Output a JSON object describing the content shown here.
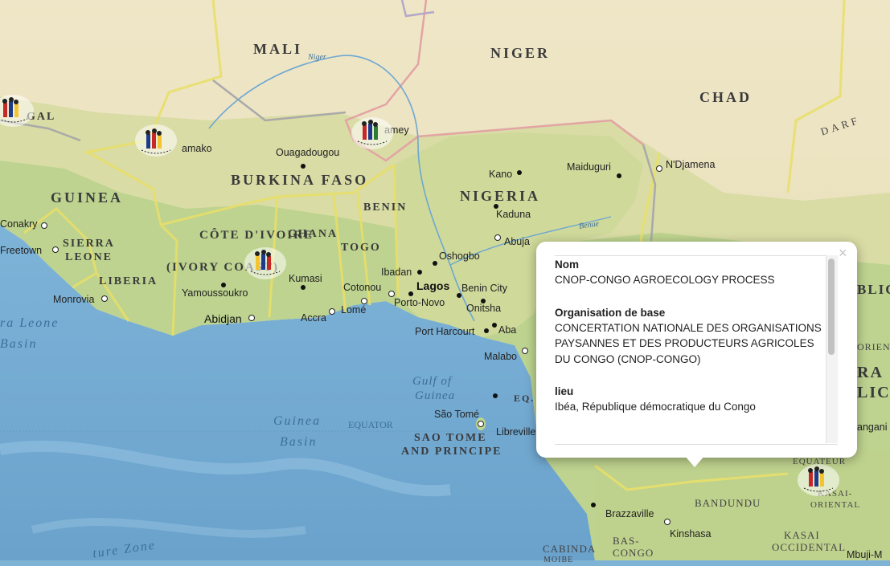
{
  "map": {
    "countries": [
      "MALI",
      "NIGER",
      "CHAD",
      "GUINEA",
      "BURKINA FASO",
      "NIGERIA",
      "BENIN",
      "GHANA",
      "TOGO",
      "CÔTE D'IVOIRE",
      "(IVORY COAST)",
      "SIERRA",
      "LEONE",
      "LIBERIA",
      "GAL",
      "SAO TOME",
      "AND PRINCIPE",
      "EQ. G",
      "DARF",
      "BLIC",
      "RA",
      "LIC"
    ],
    "regions": [
      "BANDUNDU",
      "KASAI",
      "OCCIDENTAL",
      "BAS-",
      "CONGO",
      "EQUATEUR",
      "KASAI-",
      "ORIENTAL",
      "ORIEN",
      "CABINDA",
      "MOIBE"
    ],
    "cities": [
      "Conakry",
      "Freetown",
      "Monrovia",
      "Yamoussoukro",
      "Abidjan",
      "Kumasi",
      "Accra",
      "Lomé",
      "Cotonou",
      "Porto-Novo",
      "Lagos",
      "Ibadan",
      "Oshogbo",
      "Benin City",
      "Onitsha",
      "Port Harcourt",
      "Aba",
      "Abuja",
      "Kaduna",
      "Kano",
      "Maiduguri",
      "N'Djamena",
      "Ouagadougou",
      "Bamako",
      "amako",
      "amey",
      "Malabo",
      "São Tomé",
      "Libreville",
      "Brazzaville",
      "Kinshasa",
      "Mbuji-M",
      "angani"
    ],
    "water": [
      "Gulf of",
      "Guinea",
      "Guinea",
      "Basin",
      "ra Leone",
      "Basin",
      "EQUATOR",
      "ture Zone",
      "Niger",
      "Benue"
    ]
  },
  "popup": {
    "close_label": "×",
    "fields": [
      {
        "label": "Nom",
        "value": "CNOP-CONGO AGROECOLOGY PROCESS"
      },
      {
        "label": "Organisation de base",
        "value": "CONCERTATION NATIONALE DES ORGANISATIONS PAYSANNES ET DES PRODUCTEURS AGRICOLES DU CONGO (CNOP-CONGO)"
      },
      {
        "label": "lieu",
        "value": "Ibéa, République démocratique du Congo"
      }
    ]
  },
  "colors": {
    "ocean": "#7fb3d6",
    "land_sahel": "#e9e1c2",
    "land_savanna": "#d7dca0",
    "land_green": "#b9d28e",
    "border_yellow": "#e8df6a",
    "border_pink": "#e6a9a9",
    "border_grey": "#a7a7a7"
  }
}
